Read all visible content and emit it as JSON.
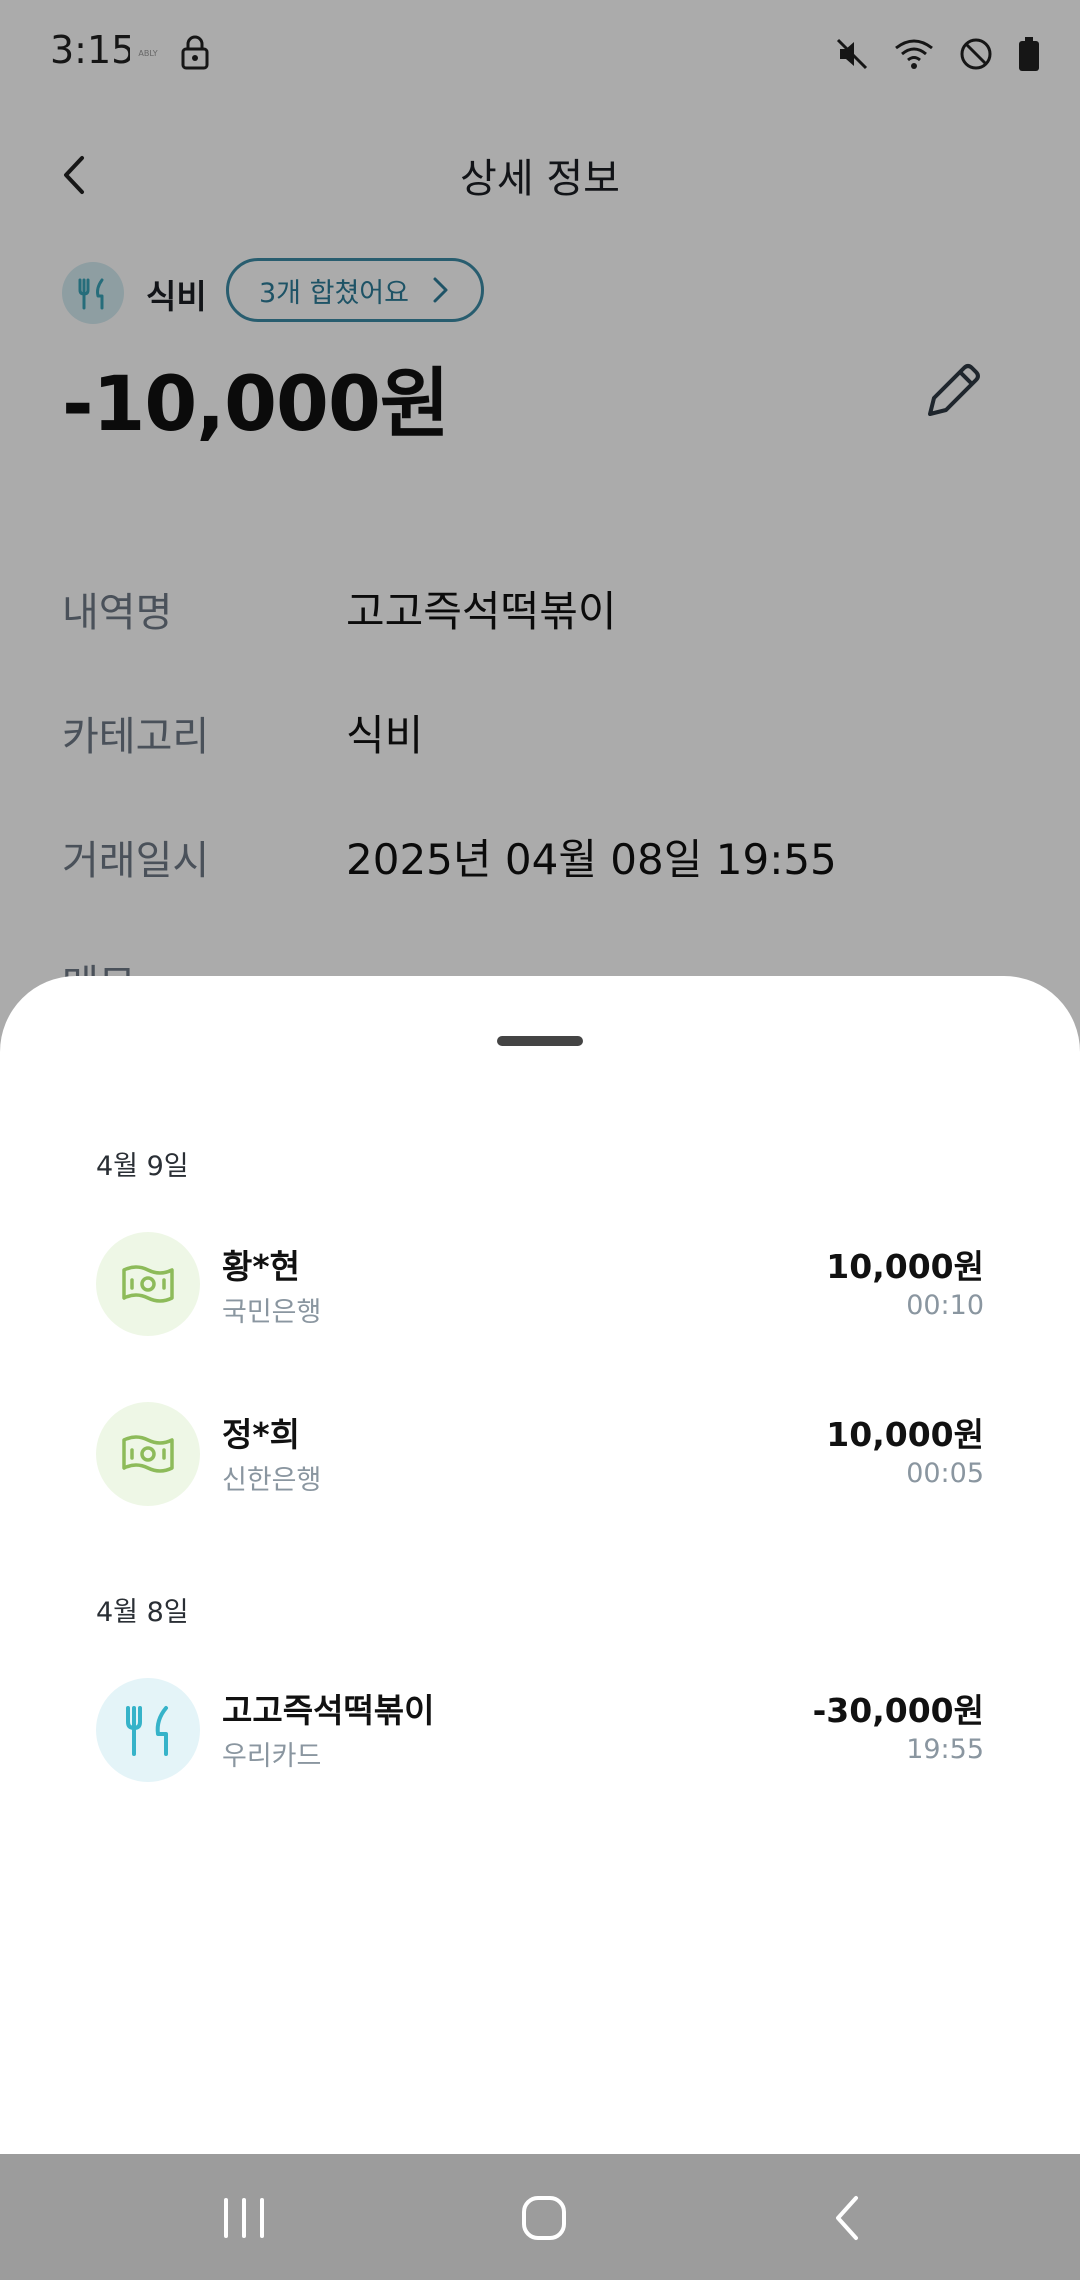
{
  "status_bar": {
    "time": "3:15",
    "app_label": "ABLY"
  },
  "header": {
    "title": "상세 정보"
  },
  "summary": {
    "category": "식비",
    "merge_chip": "3개 합쳤어요",
    "amount": "-10,000원"
  },
  "details": [
    {
      "label": "내역명",
      "value": "고고즉석떡볶이"
    },
    {
      "label": "카테고리",
      "value": "식비"
    },
    {
      "label": "거래일시",
      "value": "2025년 04월 08일 19:55"
    },
    {
      "label": "메모",
      "value": ""
    }
  ],
  "sheet": {
    "groups": [
      {
        "date": "4월 9일",
        "items": [
          {
            "name": "황*현",
            "sub": "국민은행",
            "amount": "10,000원",
            "time": "00:10",
            "icon": "money-icon"
          },
          {
            "name": "정*희",
            "sub": "신한은행",
            "amount": "10,000원",
            "time": "00:05",
            "icon": "money-icon"
          }
        ]
      },
      {
        "date": "4월 8일",
        "items": [
          {
            "name": "고고즉석떡볶이",
            "sub": "우리카드",
            "amount": "-30,000원",
            "time": "19:55",
            "icon": "utensils-icon"
          }
        ]
      }
    ]
  },
  "colors": {
    "accent": "#2d7d99",
    "money_icon_bg": "#eef7e6",
    "money_icon": "#8dbb5a",
    "food_icon_bg": "#e4f4f8",
    "food_icon": "#36b3c9"
  }
}
